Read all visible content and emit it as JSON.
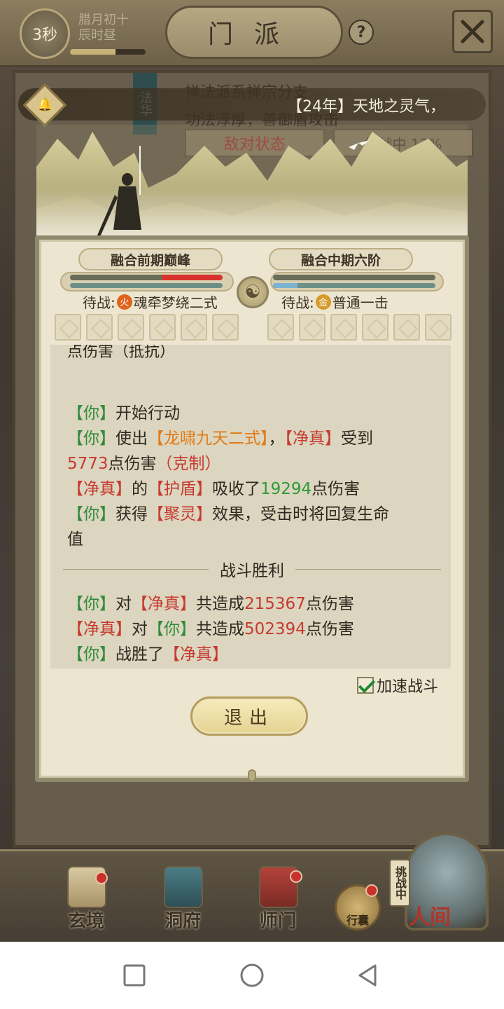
{
  "header": {
    "timer": "3秒",
    "date_line1": "腊月初十",
    "date_line2": "辰时昼",
    "title": "门派",
    "help": "?"
  },
  "sect_background": {
    "line1": "禅法派系禅宗分支",
    "line2": "功法淳厚，善御盾攻击",
    "badge": "法华",
    "btn_state": "敌对状态",
    "btn_challenge": "挑战中 12%"
  },
  "marquee": {
    "text": "【24年】天地之灵气，"
  },
  "battle": {
    "left": {
      "realm": "融合前期巅峰",
      "hp_fraction": 0.6,
      "hp_color": "#d9322c",
      "mp_fraction": 0.0,
      "wait_label": "待战:",
      "element": "火",
      "element_color": "#e0631c",
      "skill": "魂牵梦绕二式"
    },
    "right": {
      "realm": "融合中期六阶",
      "hp_fraction": 1.0,
      "hp_color": "#6b6d58",
      "mp_fraction": 0.15,
      "wait_label": "待战:",
      "element": "金",
      "element_color": "#d69a2a",
      "skill": "普通一击"
    },
    "taiji": "☯"
  },
  "log": {
    "partial_top": "点伤害（抵抗）",
    "lines": [
      {
        "parts": [
          {
            "t": "【你】",
            "c": "c-green"
          },
          {
            "t": "开始行动",
            "c": ""
          }
        ]
      },
      {
        "parts": [
          {
            "t": "【你】",
            "c": "c-green"
          },
          {
            "t": "使出",
            "c": ""
          },
          {
            "t": "【龙啸九天二式】",
            "c": "c-orange"
          },
          {
            "t": "，",
            "c": ""
          },
          {
            "t": "【净真】",
            "c": "c-red"
          },
          {
            "t": "受到",
            "c": ""
          }
        ]
      },
      {
        "parts": [
          {
            "t": "5773",
            "c": "c-num-red"
          },
          {
            "t": "点伤害",
            "c": ""
          },
          {
            "t": "（克制）",
            "c": "c-red"
          }
        ]
      },
      {
        "parts": [
          {
            "t": "【净真】",
            "c": "c-red"
          },
          {
            "t": "的",
            "c": ""
          },
          {
            "t": "【护盾】",
            "c": "c-red"
          },
          {
            "t": "吸收了",
            "c": ""
          },
          {
            "t": "19294",
            "c": "c-num-green"
          },
          {
            "t": "点伤害",
            "c": ""
          }
        ]
      },
      {
        "parts": [
          {
            "t": "【你】",
            "c": "c-green"
          },
          {
            "t": "获得",
            "c": ""
          },
          {
            "t": "【聚灵】",
            "c": "c-red"
          },
          {
            "t": "效果，受击时将回复生命",
            "c": ""
          }
        ]
      },
      {
        "parts": [
          {
            "t": "值",
            "c": ""
          }
        ]
      }
    ],
    "divider": "战斗胜利",
    "summary": [
      {
        "parts": [
          {
            "t": "【你】",
            "c": "c-green"
          },
          {
            "t": "对",
            "c": ""
          },
          {
            "t": "【净真】",
            "c": "c-red"
          },
          {
            "t": "共造成",
            "c": ""
          },
          {
            "t": "215367",
            "c": "c-num-red"
          },
          {
            "t": "点伤害",
            "c": ""
          }
        ]
      },
      {
        "parts": [
          {
            "t": "【净真】",
            "c": "c-red"
          },
          {
            "t": "对",
            "c": ""
          },
          {
            "t": "【你】",
            "c": "c-green"
          },
          {
            "t": "共造成",
            "c": ""
          },
          {
            "t": "502394",
            "c": "c-num-red"
          },
          {
            "t": "点伤害",
            "c": ""
          }
        ]
      },
      {
        "parts": [
          {
            "t": "【你】",
            "c": "c-green"
          },
          {
            "t": "战胜了",
            "c": ""
          },
          {
            "t": "【净真】",
            "c": "c-red"
          }
        ]
      }
    ]
  },
  "controls": {
    "speed_label": "加速战斗",
    "speed_checked": true,
    "exit_label": "退出"
  },
  "nav": {
    "items": [
      {
        "label": "玄境",
        "icon": "scroll-icon"
      },
      {
        "label": "洞府",
        "icon": "pavilion-icon"
      },
      {
        "label": "师门",
        "icon": "banner-icon"
      }
    ],
    "bag_label": "行囊",
    "renjian_label": "人间",
    "challenge_tag": "挑战中"
  },
  "system_nav": {
    "icons": [
      "recents-icon",
      "home-icon",
      "back-icon"
    ]
  }
}
